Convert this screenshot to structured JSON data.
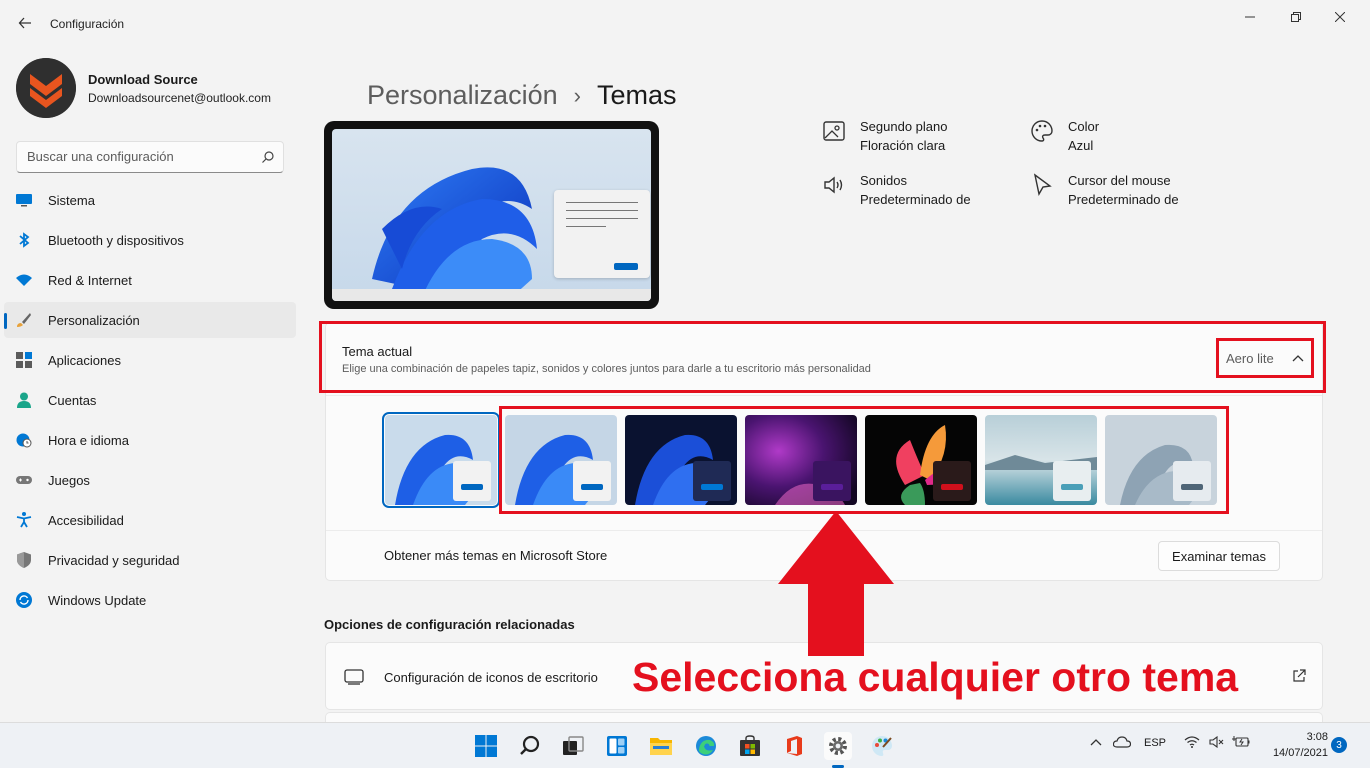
{
  "window": {
    "title": "Configuración"
  },
  "profile": {
    "name": "Download Source",
    "email": "Downloadsourcenet@outlook.com"
  },
  "search": {
    "placeholder": "Buscar una configuración"
  },
  "sidebar": {
    "items": [
      {
        "label": "Sistema",
        "icon": "system-icon"
      },
      {
        "label": "Bluetooth y dispositivos",
        "icon": "bluetooth-icon"
      },
      {
        "label": "Red & Internet",
        "icon": "wifi-icon"
      },
      {
        "label": "Personalización",
        "icon": "brush-icon",
        "active": true
      },
      {
        "label": "Aplicaciones",
        "icon": "apps-icon"
      },
      {
        "label": "Cuentas",
        "icon": "person-icon"
      },
      {
        "label": "Hora e idioma",
        "icon": "clock-globe-icon"
      },
      {
        "label": "Juegos",
        "icon": "gamepad-icon"
      },
      {
        "label": "Accesibilidad",
        "icon": "accessibility-icon"
      },
      {
        "label": "Privacidad y seguridad",
        "icon": "shield-icon"
      },
      {
        "label": "Windows Update",
        "icon": "update-icon"
      }
    ]
  },
  "breadcrumb": {
    "parent": "Personalización",
    "separator": "›",
    "current": "Temas"
  },
  "theme_props": {
    "background": {
      "title": "Segundo plano",
      "value": "Floración clara"
    },
    "color": {
      "title": "Color",
      "value": "Azul"
    },
    "sounds": {
      "title": "Sonidos",
      "value": "Predeterminado de"
    },
    "cursor": {
      "title": "Cursor del mouse",
      "value": "Predeterminado de"
    }
  },
  "current_theme": {
    "title": "Tema actual",
    "description": "Elige una combinación de papeles tapiz, sonidos y colores juntos para darle a tu escritorio más personalidad",
    "selected": "Aero lite"
  },
  "themes": [
    {
      "name": "aero-lite",
      "accent": "#0067c0",
      "selected": true
    },
    {
      "name": "windows-light",
      "accent": "#0067c0"
    },
    {
      "name": "windows-dark",
      "accent": "#0078d4"
    },
    {
      "name": "glow",
      "accent": "#5a1e9a"
    },
    {
      "name": "captured-motion",
      "accent": "#d0101c"
    },
    {
      "name": "sunrise",
      "accent": "#4a9fb8"
    },
    {
      "name": "flow",
      "accent": "#4f6577"
    }
  ],
  "store": {
    "text": "Obtener más temas en Microsoft Store",
    "button": "Examinar temas"
  },
  "related": {
    "title": "Opciones de configuración relacionadas",
    "item": "Configuración de iconos de escritorio"
  },
  "annotation": {
    "text": "Selecciona cualquier otro tema",
    "color": "#e4101e"
  },
  "taskbar": {
    "language": "ESP",
    "time": "3:08",
    "date": "14/07/2021",
    "notifications": "3"
  },
  "colors": {
    "accent": "#0067c0",
    "highlight": "#e4101e"
  }
}
